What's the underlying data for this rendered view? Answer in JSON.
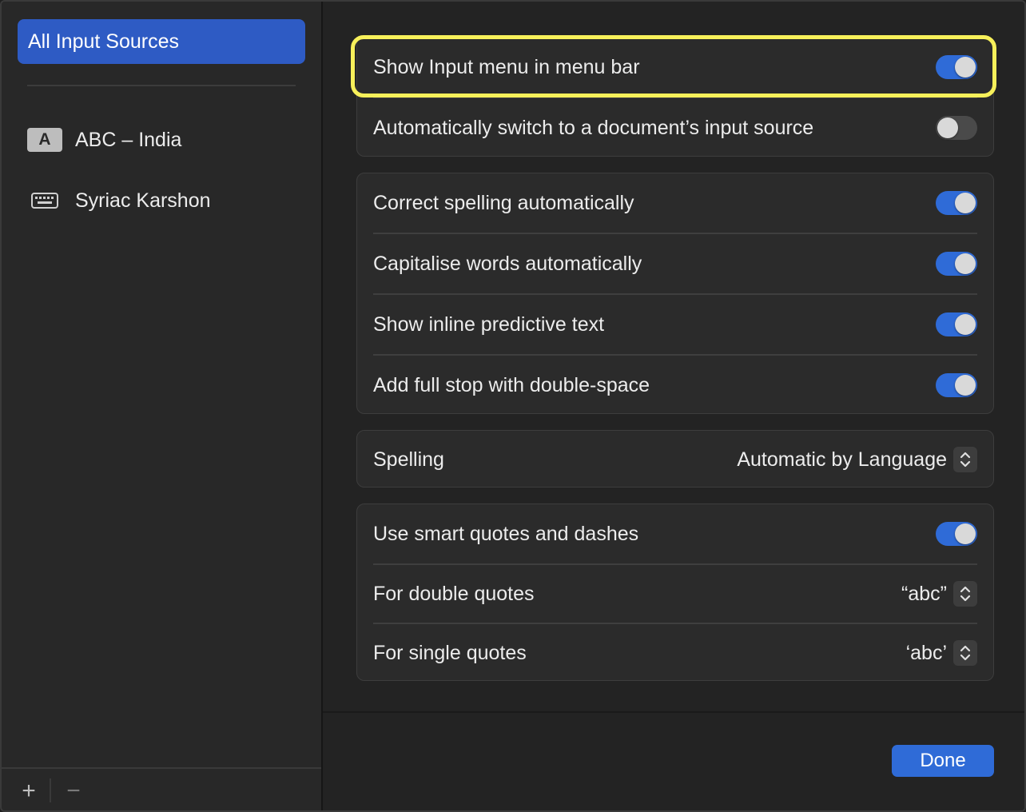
{
  "sidebar": {
    "selected_label": "All Input Sources",
    "sources": [
      {
        "label": "ABC – India",
        "icon": "letter-a-icon",
        "icon_text": "A"
      },
      {
        "label": "Syriac Karshon",
        "icon": "keyboard-icon"
      }
    ],
    "add_label": "+",
    "remove_label": "−"
  },
  "main": {
    "group1": [
      {
        "label": "Show Input menu in menu bar",
        "state": "on"
      },
      {
        "label": "Automatically switch to a document’s input source",
        "state": "off"
      }
    ],
    "group2": [
      {
        "label": "Correct spelling automatically",
        "state": "on"
      },
      {
        "label": "Capitalise words automatically",
        "state": "on"
      },
      {
        "label": "Show inline predictive text",
        "state": "on"
      },
      {
        "label": "Add full stop with double-space",
        "state": "on"
      }
    ],
    "spelling": {
      "label": "Spelling",
      "value": "Automatic by Language"
    },
    "group4": {
      "smart_quotes": {
        "label": "Use smart quotes and dashes",
        "state": "on"
      },
      "double_quotes": {
        "label": "For double quotes",
        "value": "“abc”"
      },
      "single_quotes": {
        "label": "For single quotes",
        "value": "‘abc’"
      }
    },
    "done_label": "Done"
  },
  "colors": {
    "accent": "#2f6bd7",
    "highlight": "#f7f05a",
    "selection": "#2e5bc4"
  }
}
